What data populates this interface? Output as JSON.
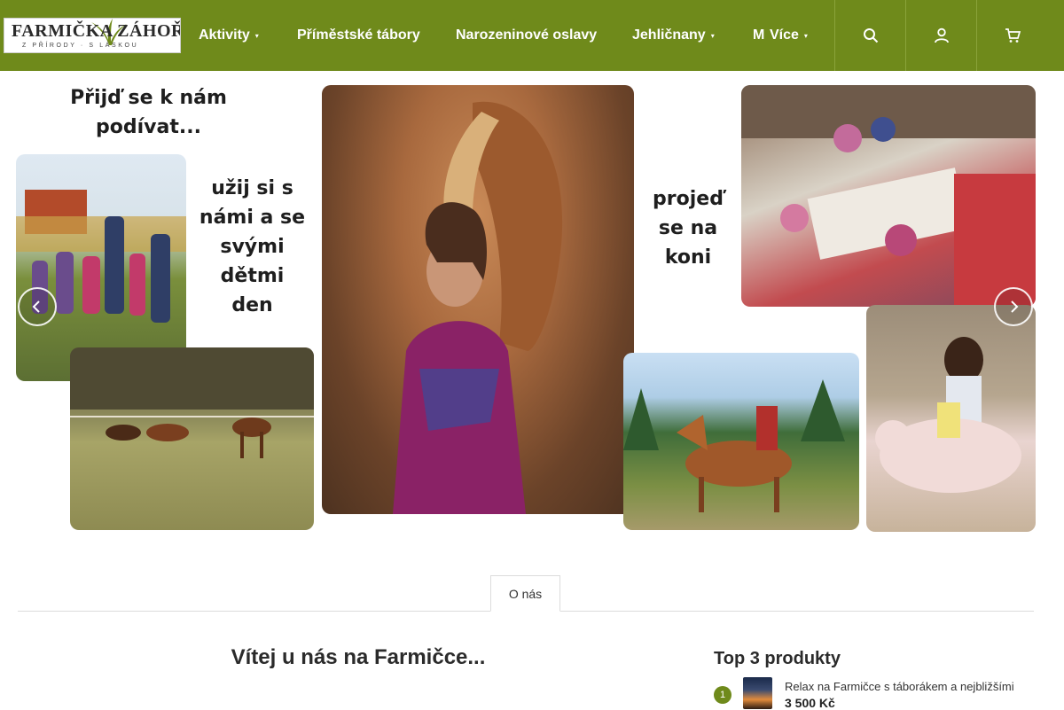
{
  "brand": {
    "logo_main": "FARMIČKA ZÁHOŘÍ",
    "logo_tagline": "Z PŘÍRODY · S LÁSKOU"
  },
  "colors": {
    "header": "#6f8a1b",
    "accent": "#6f8a1b"
  },
  "nav": {
    "items": [
      {
        "label": "Aktivity",
        "has_dropdown": true
      },
      {
        "label": "Příměstské tábory",
        "has_dropdown": false
      },
      {
        "label": "Narozeninové oslavy",
        "has_dropdown": false
      },
      {
        "label": "Jehličnany",
        "has_dropdown": true
      },
      {
        "label": "M",
        "has_dropdown": false
      },
      {
        "label": "Více",
        "has_dropdown": true
      }
    ],
    "header_buttons": [
      {
        "icon": "search-icon"
      },
      {
        "icon": "user-icon"
      },
      {
        "icon": "cart-icon"
      }
    ]
  },
  "banner": {
    "text_1": "Přijď se k nám podívat...",
    "text_2": "užij si s námi a se svými dětmi den",
    "text_3": "projeď se na koni",
    "prev_icon": "chevron-left-icon",
    "next_icon": "chevron-right-icon"
  },
  "tabs": [
    {
      "label": "O nás",
      "active": true
    }
  ],
  "content": {
    "welcome_heading": "Vítej u nás na Farmičce..."
  },
  "top_products": {
    "title": "Top 3 produkty",
    "items": [
      {
        "rank": "1",
        "name": "Relax na Farmičce s táborákem a nejbližšími",
        "price": "3 500 Kč"
      }
    ]
  }
}
